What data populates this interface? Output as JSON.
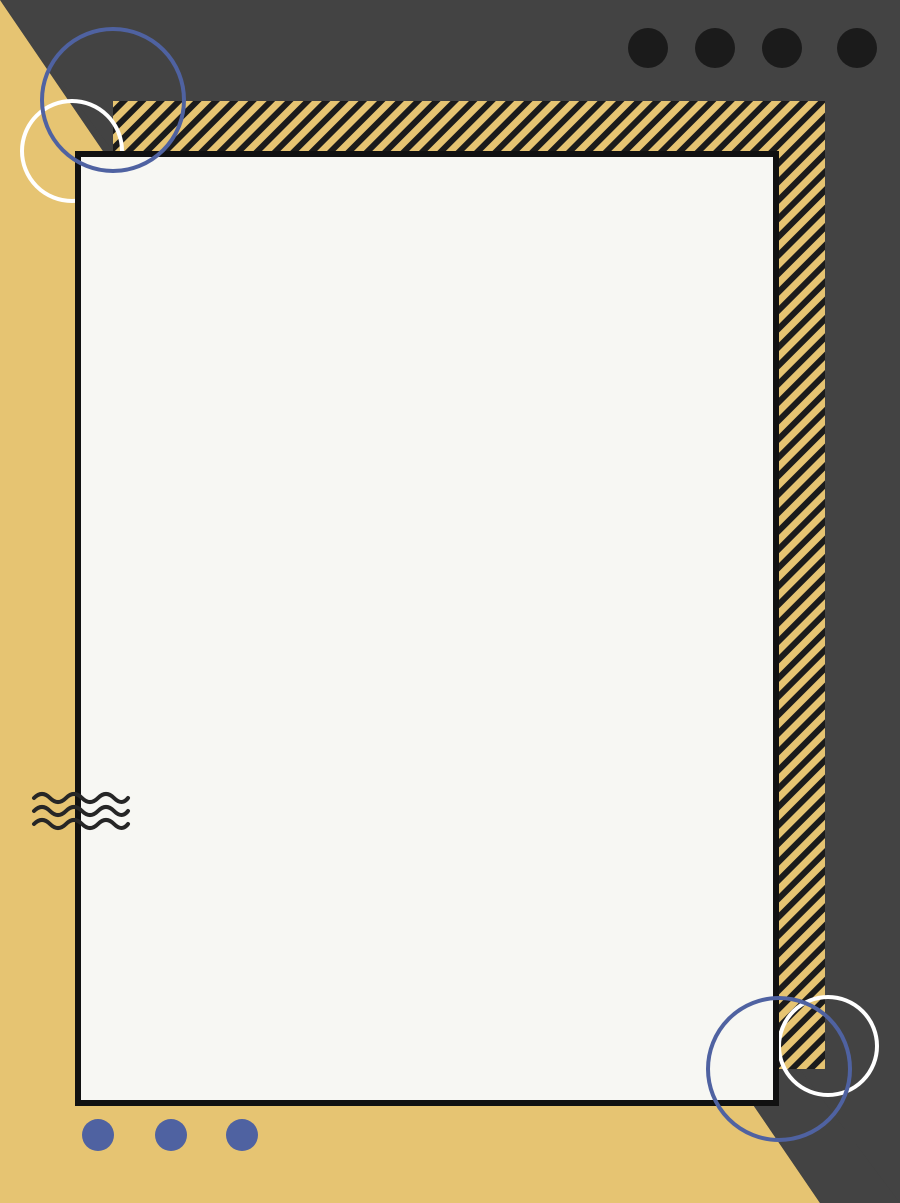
{
  "colors": {
    "mustard": "#e6c472",
    "charcoal": "#434343",
    "paper": "#f7f7f3",
    "ink": "#1b1b1b",
    "blue": "#4f62a1",
    "white": "#ffffff"
  },
  "decor": {
    "top_dots": {
      "count": 4,
      "color": "#1b1b1b"
    },
    "bottom_dots": {
      "count": 3,
      "color": "#4f62a1"
    },
    "wave_lines": 3,
    "stripe_band": "diagonal-stripes",
    "panel": "blank-paper-card"
  }
}
